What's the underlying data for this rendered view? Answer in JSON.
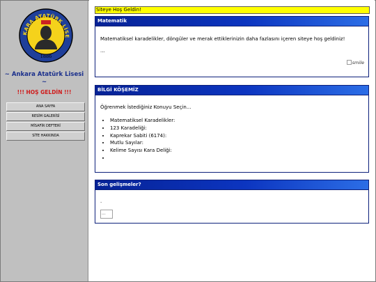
{
  "sidebar": {
    "logo": {
      "ring_text": "ANKARA ATATÜRK LİSESİ",
      "year": "1886",
      "colors": {
        "ring": "#1f3f9a",
        "inner": "#f5d21b",
        "outline": "#000000"
      }
    },
    "school_name_line1": "~ Ankara Atatürk Lisesi",
    "school_name_line2": "~",
    "welcome": "!!! HOŞ GELDİN !!!",
    "nav": [
      {
        "label": "ANA SAYFA"
      },
      {
        "label": "RESİM GALERİSİ"
      },
      {
        "label": "MİSAFİR DEFTERİ"
      },
      {
        "label": "SİTE HAKKINDA"
      }
    ]
  },
  "main": {
    "welcome_bar": "Siteye Hoş Geldin!",
    "panels": [
      {
        "title": "Matematik",
        "intro": "Matematiksel karadelikler, döngüler ve merak ettiklerinizin daha fazlasını içeren siteye hoş geldiniz!",
        "ellipsis": "...",
        "image_alt": "smile"
      },
      {
        "title": "BİLGİ KÖŞEMİZ",
        "prompt": "Öğrenmek İstediğiniz Konuyu Seçin...",
        "items": [
          "Matematiksel Karadelikler:",
          "123 Karadeliği:",
          "Kaprekar Sabiti (6174):",
          "Mutlu Sayılar:",
          "Kelime Sayısı Kara Deliği:",
          ""
        ]
      },
      {
        "title": "Son gelişmeler?",
        "dot": ".",
        "image_alt": "..."
      }
    ]
  },
  "colors": {
    "sidebar_bg": "#c0c0c0",
    "school_name": "#1a2f8c",
    "welcome_red": "#d01a1a",
    "welcome_bar": "#ffff00",
    "panel_header": "#062296"
  }
}
